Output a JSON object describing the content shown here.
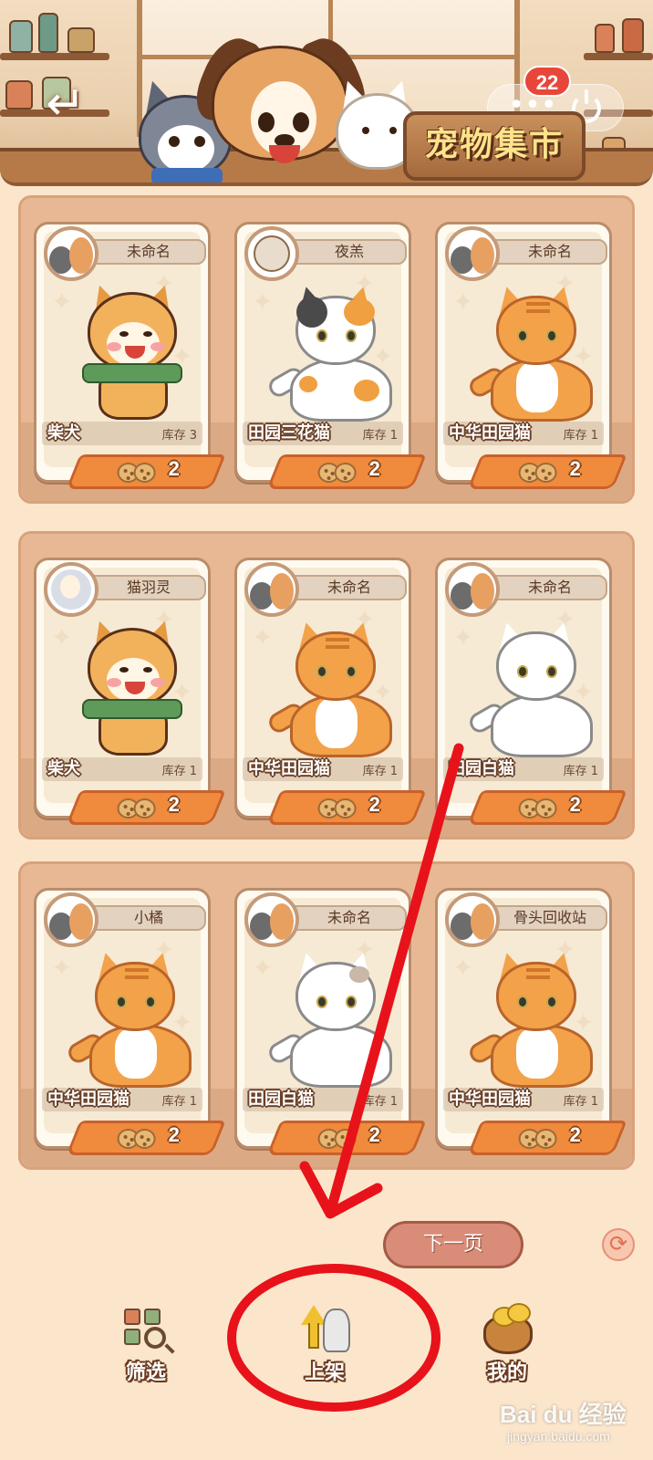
{
  "header": {
    "title": "宠物集市",
    "badge_count": "22",
    "back_icon": "back-arrow-icon",
    "more_icon": "more-dots-icon",
    "power_icon": "power-icon"
  },
  "cards": [
    {
      "owner": "未命名",
      "pet": "柴犬",
      "stock": "库存 3",
      "price": "2",
      "kind": "shiba",
      "avatar": "corgi-cat"
    },
    {
      "owner": "夜羔",
      "pet": "田园三花猫",
      "stock": "库存 1",
      "price": "2",
      "kind": "calico",
      "avatar": "bulldog"
    },
    {
      "owner": "未命名",
      "pet": "中华田园猫",
      "stock": "库存 1",
      "price": "2",
      "kind": "orange",
      "avatar": "corgi-cat"
    },
    {
      "owner": "猫羽灵",
      "pet": "柴犬",
      "stock": "库存 1",
      "price": "2",
      "kind": "shiba",
      "avatar": "anime"
    },
    {
      "owner": "未命名",
      "pet": "中华田园猫",
      "stock": "库存 1",
      "price": "2",
      "kind": "orange",
      "avatar": "corgi-cat"
    },
    {
      "owner": "未命名",
      "pet": "田园白猫",
      "stock": "库存 1",
      "price": "2",
      "kind": "white",
      "avatar": "corgi-cat"
    },
    {
      "owner": "小橘",
      "pet": "中华田园猫",
      "stock": "库存 1",
      "price": "2",
      "kind": "orange",
      "avatar": "corgi-cat"
    },
    {
      "owner": "未命名",
      "pet": "田园白猫",
      "stock": "库存 1",
      "price": "2",
      "kind": "white-patch",
      "avatar": "corgi-cat"
    },
    {
      "owner": "骨头回收站",
      "pet": "中华田园猫",
      "stock": "库存 1",
      "price": "2",
      "kind": "orange",
      "avatar": "corgi-cat"
    }
  ],
  "pagination": {
    "next_label": "下一页",
    "refresh_icon": "refresh-icon"
  },
  "nav": {
    "filter_label": "筛选",
    "list_label": "上架",
    "mine_label": "我的"
  },
  "watermark": {
    "brand": "Bai du 经验",
    "url": "jingyan.baidu.com"
  },
  "colors": {
    "accent_orange": "#f08a3c",
    "annotation_red": "#e8121a",
    "background": "#fbe6cc"
  }
}
